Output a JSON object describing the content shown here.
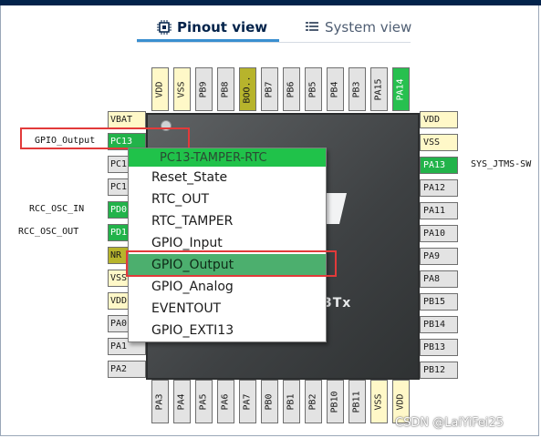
{
  "tabs": {
    "pinout": "Pinout view",
    "system": "System view"
  },
  "chip": {
    "text": "3Tx"
  },
  "pins_top": [
    "VDD",
    "VSS",
    "PB9",
    "PB8",
    "BOO..",
    "PB7",
    "PB6",
    "PB5",
    "PB4",
    "PB3",
    "PA15",
    "PA14"
  ],
  "pins_bottom": [
    "PA3",
    "PA4",
    "PA5",
    "PA6",
    "PA7",
    "PB0",
    "PB1",
    "PB2",
    "PB10",
    "PB11",
    "VSS",
    "VDD"
  ],
  "pins_left": [
    "VBAT",
    "PC13",
    "PC1",
    "PC1",
    "PD0",
    "PD1",
    "NR",
    "VSS",
    "VDD",
    "PA0",
    "PA1",
    "PA2"
  ],
  "pins_right": [
    "VDD",
    "VSS",
    "PA13",
    "PA12",
    "PA11",
    "PA10",
    "PA9",
    "PA8",
    "PB15",
    "PB14",
    "PB13",
    "PB12"
  ],
  "side_labels": {
    "gpio_output": "GPIO_Output",
    "rcc_osc_in": "RCC_OSC_IN",
    "rcc_osc_out": "RCC_OSC_OUT",
    "sys_jtms": "SYS_JTMS-SW"
  },
  "menu": {
    "header": "PC13-TAMPER-RTC",
    "items": [
      "Reset_State",
      "RTC_OUT",
      "RTC_TAMPER",
      "GPIO_Input",
      "GPIO_Output",
      "GPIO_Analog",
      "EVENTOUT",
      "GPIO_EXTI13"
    ],
    "selected": "GPIO_Output"
  },
  "watermark": "CSDN @LaiYiFei25",
  "colors": {
    "header_bar": "#03234b",
    "pin_green": "#22b34a",
    "annotation": "#e23a3a",
    "selected_item": "#4caf6e"
  }
}
